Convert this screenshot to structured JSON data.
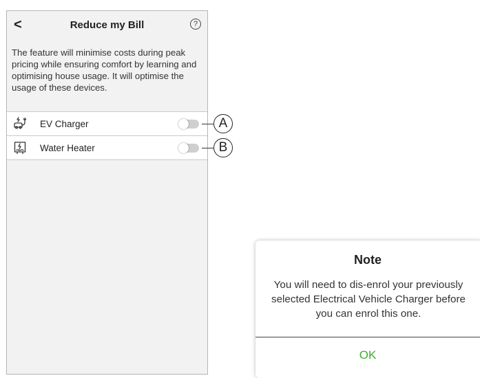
{
  "header": {
    "back_icon": "chevron-left-icon",
    "back_glyph": "<",
    "title": "Reduce my Bill",
    "help_icon": "help-icon",
    "help_glyph": "?"
  },
  "description": "The feature will minimise costs during peak pricing while ensuring comfort by learning and optimising house usage. It will optimise the usage of these devices.",
  "devices": [
    {
      "icon": "ev-charger-icon",
      "label": "EV Charger",
      "enabled": false,
      "callout": "A"
    },
    {
      "icon": "water-heater-icon",
      "label": "Water Heater",
      "enabled": false,
      "callout": "B"
    }
  ],
  "dialog": {
    "title": "Note",
    "body": "You will need to dis-enrol your previously selected Electrical Vehicle Charger before you can enrol this one.",
    "ok_label": "OK"
  },
  "colors": {
    "accent": "#3dae2b",
    "toggle_off": "#cfcfcf",
    "screen_background": "#f2f2f2"
  }
}
